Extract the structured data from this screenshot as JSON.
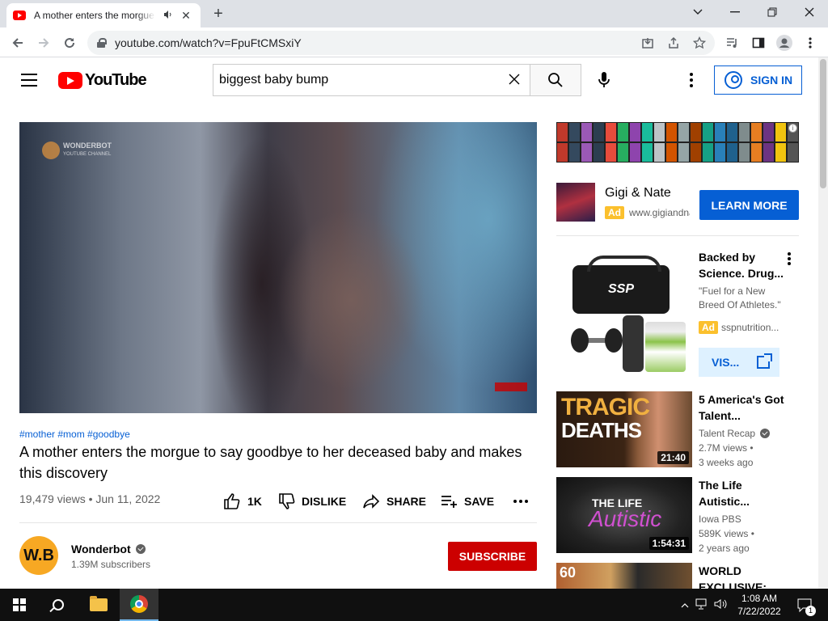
{
  "browser": {
    "tab_title": "A mother enters the morgue to say goodbye to her deceased baby and makes this discovery",
    "url": "youtube.com/watch?v=FpuFtCMSxiY",
    "icons": [
      "speaker-icon",
      "close-icon",
      "new-tab-icon",
      "minimize-icon",
      "maximize-icon",
      "window-close-icon",
      "back-icon",
      "forward-icon",
      "reload-icon",
      "lock-icon",
      "install-icon",
      "share-icon",
      "star-icon",
      "media-icon",
      "sidepanel-icon",
      "profile-icon",
      "menu-icon"
    ]
  },
  "youtube": {
    "logo_text": "YouTube",
    "search_value": "biggest baby bump",
    "sign_in": "SIGN IN"
  },
  "video": {
    "watermark": "WONDERBOT",
    "watermark_sub": "YOUTUBE CHANNEL",
    "hashtags": "#mother #mom #goodbye",
    "title": "A mother enters the morgue to say goodbye to her deceased baby and makes this discovery",
    "views_date": "19,479 views • Jun 11, 2022",
    "actions": {
      "like": "1K",
      "dislike": "DISLIKE",
      "share": "SHARE",
      "save": "SAVE"
    },
    "channel": {
      "avatar_text": "W.B",
      "name": "Wonderbot",
      "subscribers": "1.39M subscribers"
    },
    "subscribe": "SUBSCRIBE"
  },
  "sidebar": {
    "ad1": {
      "title": "Gigi & Nate",
      "ad_label": "Ad",
      "domain": "www.gigiandnate.com",
      "cta": "LEARN MORE"
    },
    "ad2": {
      "product_text": "SSP",
      "title": "Backed by Science. Drug...",
      "quote": "\"Fuel for a New Breed Of Athletes.\"",
      "ad_label": "Ad",
      "domain": "sspnutrition...",
      "cta": "VIS..."
    },
    "recommendations": [
      {
        "title": "5 America's Got Talent...",
        "channel": "Talent Recap",
        "views": "2.7M views •",
        "age": "3 weeks ago",
        "duration": "21:40",
        "thumb_text": "TRAGIC",
        "thumb_text2": "DEATHS"
      },
      {
        "title": "The Life Autistic...",
        "channel": "Iowa PBS",
        "views": "589K views •",
        "age": "2 years ago",
        "duration": "1:54:31",
        "thumb_text": "THE LIFE",
        "thumb_text2": "Autistic"
      },
      {
        "title": "WORLD EXCLUSIVE:",
        "thumb_text": "60"
      }
    ]
  },
  "taskbar": {
    "time": "1:08 AM",
    "date": "7/22/2022",
    "notifications": "1"
  }
}
